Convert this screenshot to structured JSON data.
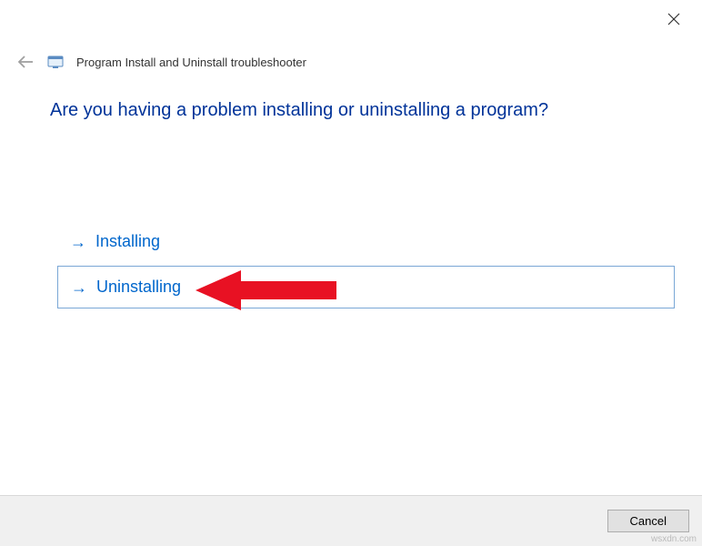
{
  "header": {
    "window_title": "Program Install and Uninstall troubleshooter"
  },
  "content": {
    "question": "Are you having a problem installing or uninstalling a program?",
    "options": {
      "installing": "Installing",
      "uninstalling": "Uninstalling"
    }
  },
  "footer": {
    "cancel_label": "Cancel"
  },
  "watermark": "wsxdn.com"
}
